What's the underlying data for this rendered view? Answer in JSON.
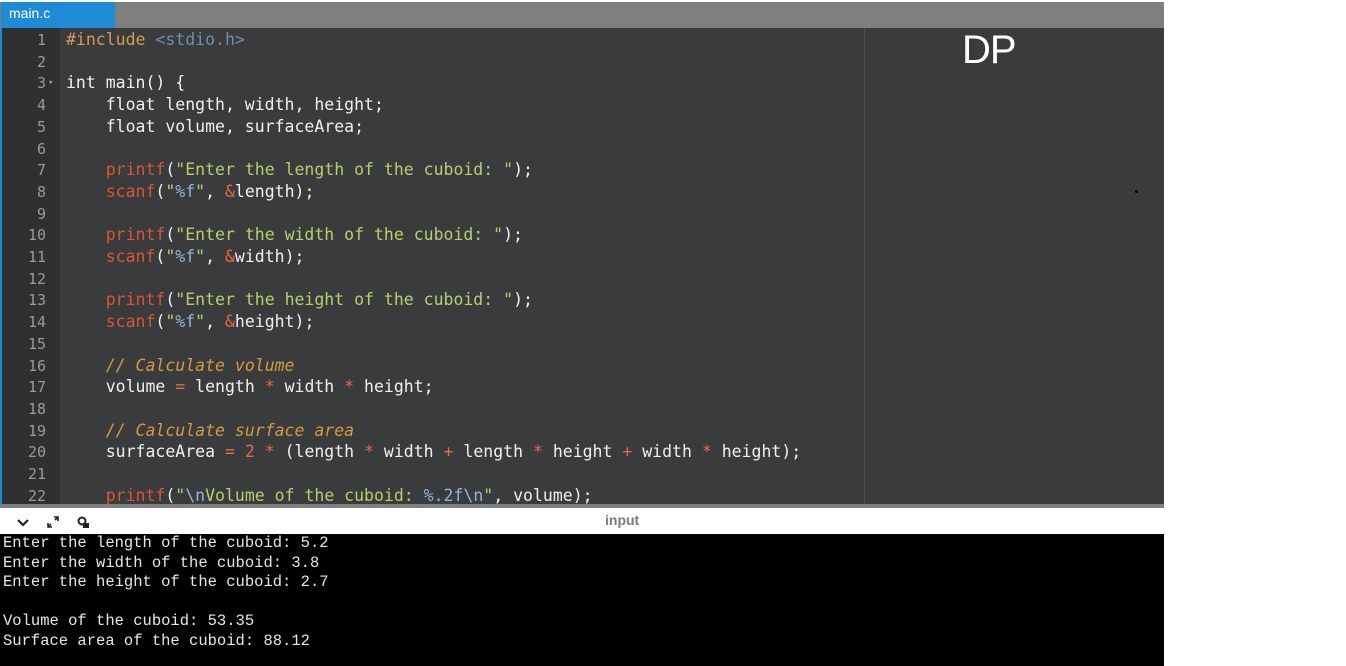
{
  "tab": {
    "filename": "main.c"
  },
  "editor": {
    "lines": [
      {
        "n": "1",
        "segs": [
          {
            "c": "t-inc",
            "t": "#include "
          },
          {
            "c": "t-hdr",
            "t": "<stdio.h>"
          }
        ]
      },
      {
        "n": "2",
        "segs": []
      },
      {
        "n": "3",
        "fold": true,
        "segs": [
          {
            "c": "",
            "t": "int main() {"
          }
        ]
      },
      {
        "n": "4",
        "segs": [
          {
            "c": "",
            "t": "    float length, width, height;"
          }
        ]
      },
      {
        "n": "5",
        "segs": [
          {
            "c": "",
            "t": "    float volume, surfaceArea;"
          }
        ]
      },
      {
        "n": "6",
        "segs": []
      },
      {
        "n": "7",
        "segs": [
          {
            "c": "",
            "t": "    "
          },
          {
            "c": "t-fn",
            "t": "printf"
          },
          {
            "c": "",
            "t": "("
          },
          {
            "c": "t-str",
            "t": "\"Enter the length of the cuboid: \""
          },
          {
            "c": "",
            "t": ");"
          }
        ]
      },
      {
        "n": "8",
        "segs": [
          {
            "c": "",
            "t": "    "
          },
          {
            "c": "t-fn",
            "t": "scanf"
          },
          {
            "c": "",
            "t": "("
          },
          {
            "c": "t-str",
            "t": "\""
          },
          {
            "c": "t-fmt",
            "t": "%f"
          },
          {
            "c": "t-str",
            "t": "\""
          },
          {
            "c": "",
            "t": ", "
          },
          {
            "c": "t-amp",
            "t": "&"
          },
          {
            "c": "",
            "t": "length);"
          }
        ]
      },
      {
        "n": "9",
        "segs": []
      },
      {
        "n": "10",
        "segs": [
          {
            "c": "",
            "t": "    "
          },
          {
            "c": "t-fn",
            "t": "printf"
          },
          {
            "c": "",
            "t": "("
          },
          {
            "c": "t-str",
            "t": "\"Enter the width of the cuboid: \""
          },
          {
            "c": "",
            "t": ");"
          }
        ]
      },
      {
        "n": "11",
        "segs": [
          {
            "c": "",
            "t": "    "
          },
          {
            "c": "t-fn",
            "t": "scanf"
          },
          {
            "c": "",
            "t": "("
          },
          {
            "c": "t-str",
            "t": "\""
          },
          {
            "c": "t-fmt",
            "t": "%f"
          },
          {
            "c": "t-str",
            "t": "\""
          },
          {
            "c": "",
            "t": ", "
          },
          {
            "c": "t-amp",
            "t": "&"
          },
          {
            "c": "",
            "t": "width);"
          }
        ]
      },
      {
        "n": "12",
        "segs": []
      },
      {
        "n": "13",
        "segs": [
          {
            "c": "",
            "t": "    "
          },
          {
            "c": "t-fn",
            "t": "printf"
          },
          {
            "c": "",
            "t": "("
          },
          {
            "c": "t-str",
            "t": "\"Enter the height of the cuboid: \""
          },
          {
            "c": "",
            "t": ");"
          }
        ]
      },
      {
        "n": "14",
        "segs": [
          {
            "c": "",
            "t": "    "
          },
          {
            "c": "t-fn",
            "t": "scanf"
          },
          {
            "c": "",
            "t": "("
          },
          {
            "c": "t-str",
            "t": "\""
          },
          {
            "c": "t-fmt",
            "t": "%f"
          },
          {
            "c": "t-str",
            "t": "\""
          },
          {
            "c": "",
            "t": ", "
          },
          {
            "c": "t-amp",
            "t": "&"
          },
          {
            "c": "",
            "t": "height);"
          }
        ]
      },
      {
        "n": "15",
        "segs": []
      },
      {
        "n": "16",
        "segs": [
          {
            "c": "",
            "t": "    "
          },
          {
            "c": "t-cmt",
            "t": "// Calculate volume"
          }
        ]
      },
      {
        "n": "17",
        "segs": [
          {
            "c": "",
            "t": "    volume "
          },
          {
            "c": "t-op",
            "t": "="
          },
          {
            "c": "",
            "t": " length "
          },
          {
            "c": "t-op",
            "t": "*"
          },
          {
            "c": "",
            "t": " width "
          },
          {
            "c": "t-op",
            "t": "*"
          },
          {
            "c": "",
            "t": " height;"
          }
        ]
      },
      {
        "n": "18",
        "segs": []
      },
      {
        "n": "19",
        "segs": [
          {
            "c": "",
            "t": "    "
          },
          {
            "c": "t-cmt",
            "t": "// Calculate surface area"
          }
        ]
      },
      {
        "n": "20",
        "segs": [
          {
            "c": "",
            "t": "    surfaceArea "
          },
          {
            "c": "t-op",
            "t": "="
          },
          {
            "c": "",
            "t": " "
          },
          {
            "c": "t-num",
            "t": "2"
          },
          {
            "c": "",
            "t": " "
          },
          {
            "c": "t-op",
            "t": "*"
          },
          {
            "c": "",
            "t": " (length "
          },
          {
            "c": "t-op",
            "t": "*"
          },
          {
            "c": "",
            "t": " width "
          },
          {
            "c": "t-op",
            "t": "+"
          },
          {
            "c": "",
            "t": " length "
          },
          {
            "c": "t-op",
            "t": "*"
          },
          {
            "c": "",
            "t": " height "
          },
          {
            "c": "t-op",
            "t": "+"
          },
          {
            "c": "",
            "t": " width "
          },
          {
            "c": "t-op",
            "t": "*"
          },
          {
            "c": "",
            "t": " height);"
          }
        ]
      },
      {
        "n": "21",
        "segs": []
      },
      {
        "n": "22",
        "segs": [
          {
            "c": "",
            "t": "    "
          },
          {
            "c": "t-fn",
            "t": "printf"
          },
          {
            "c": "",
            "t": "("
          },
          {
            "c": "t-str",
            "t": "\""
          },
          {
            "c": "t-esc",
            "t": "\\n"
          },
          {
            "c": "t-str",
            "t": "Volume of the cuboid: "
          },
          {
            "c": "t-fmt",
            "t": "%.2f"
          },
          {
            "c": "t-esc",
            "t": "\\n"
          },
          {
            "c": "t-str",
            "t": "\""
          },
          {
            "c": "",
            "t": ", volume);"
          }
        ]
      }
    ]
  },
  "watermark": "DP",
  "io": {
    "title": "input",
    "icons": [
      "chevron-down-icon",
      "expand-icon",
      "settings-icon"
    ]
  },
  "console": {
    "lines": [
      "Enter the length of the cuboid: 5.2",
      "Enter the width of the cuboid: 3.8",
      "Enter the height of the cuboid: 2.7",
      "",
      "Volume of the cuboid: 53.35",
      "Surface area of the cuboid: 88.12"
    ]
  }
}
